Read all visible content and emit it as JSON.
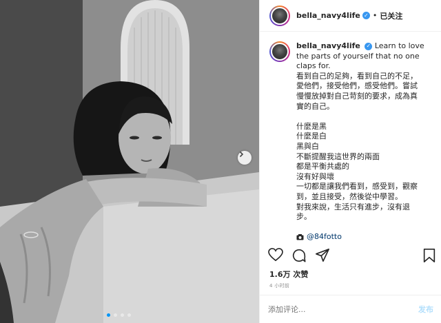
{
  "post": {
    "photo_alt": "black and white photo",
    "dots_count": 4,
    "active_dot": 0
  },
  "header": {
    "username": "bella_navy4life",
    "separator": "•",
    "follow_label": "已关注"
  },
  "caption": {
    "username": "bella_navy4life",
    "lines": [
      "Learn to love the parts of yourself that no one claps for.",
      "看到自己的足夠，看到自己的不足，",
      "愛他們，接受他們，感受他們。嘗試",
      "慢慢放掉對自己苛刻的要求，成為真",
      "實的自己。",
      "",
      "什麼是黑",
      "什麼是白",
      "黑與白",
      "不斷提醒我這世界的兩面",
      "都是平衡共處的",
      "沒有好與壞",
      "一切都是讓我們看到，感受到，觀察",
      "到，並且接受，然後從中學習。",
      "對我來說，生活只有進步，沒有退",
      "步。",
      ""
    ],
    "credit": "@84fotto"
  },
  "stats": {
    "likes": "1.6万 次赞",
    "time": "4 小时前"
  },
  "comment": {
    "placeholder": "添加评论...",
    "post_label": "发布"
  },
  "icons": {
    "like": "heart-icon",
    "comment": "comment-icon",
    "share": "share-icon",
    "save": "bookmark-icon"
  }
}
